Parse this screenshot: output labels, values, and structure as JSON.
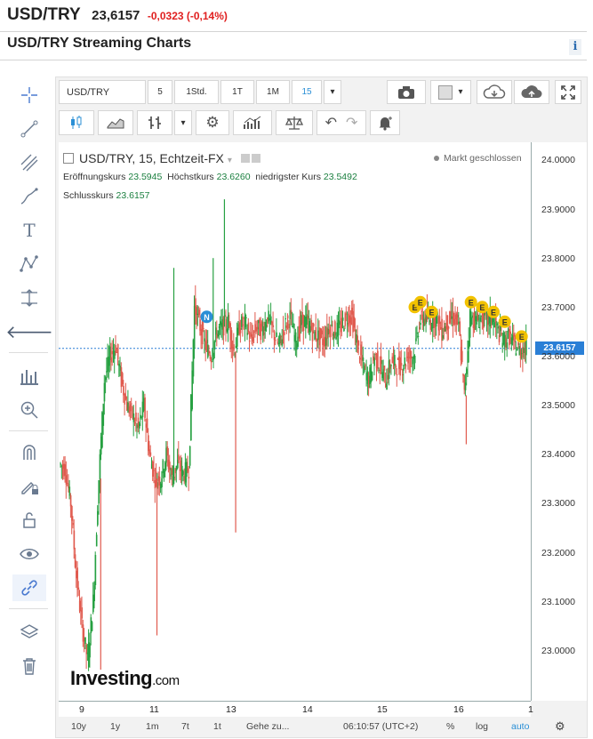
{
  "header": {
    "pair": "USD/TRY",
    "price": "23,6157",
    "change": "-0,0323 (-0,14%)"
  },
  "title": "USD/TRY Streaming Charts",
  "info_icon": "i",
  "toolbar": {
    "symbol": "USD/TRY",
    "intervals": [
      "5",
      "1Std.",
      "1T",
      "1M",
      "15"
    ],
    "active_interval": "15"
  },
  "legend": {
    "title": "USD/TRY, 15, Echtzeit-FX",
    "open_label": "Eröffnungskurs",
    "open": "23.5945",
    "high_label": "Höchstkurs",
    "high": "23.6260",
    "low_label": "niedrigster Kurs",
    "low": "23.5492",
    "close_label": "Schlusskurs",
    "close": "23.6157",
    "market_status": "Markt geschlossen"
  },
  "brand": {
    "name": "Investing",
    "suffix": ".com"
  },
  "price_tag": "23.6157",
  "bottom": {
    "ranges": [
      "10y",
      "1y",
      "1m",
      "7t",
      "1t"
    ],
    "goto": "Gehe zu...",
    "time": "06:10:57 (UTC+2)",
    "percent": "%",
    "log": "log",
    "auto": "auto"
  },
  "colors": {
    "up": "#26a041",
    "down": "#e05a4e",
    "accent": "#2a8fd6",
    "event": "#f2c200",
    "news": "#2a8fd6"
  },
  "chart_data": {
    "type": "candlestick",
    "interval": "15",
    "y_ticks": [
      23.0,
      23.1,
      23.2,
      23.3,
      23.4,
      23.5,
      23.6,
      23.7,
      23.8,
      23.9,
      24.0
    ],
    "y_tick_labels": [
      "23.0000",
      "23.1000",
      "23.2000",
      "23.3000",
      "23.4000",
      "23.5000",
      "23.6000",
      "23.7000",
      "23.8000",
      "23.9000",
      "24.0000"
    ],
    "ylim": [
      22.9,
      24.03
    ],
    "x_ticks": [
      9,
      11,
      13,
      14,
      15,
      16,
      1
    ],
    "x_tick_labels": [
      "9",
      "11",
      "13",
      "14",
      "15",
      "16",
      "1"
    ],
    "last_price": 23.6157,
    "price_path": [
      [
        0,
        23.38
      ],
      [
        1,
        23.37
      ],
      [
        2,
        23.3
      ],
      [
        3,
        23.15
      ],
      [
        4,
        23.05
      ],
      [
        5,
        22.98
      ],
      [
        6,
        23.1
      ],
      [
        7,
        23.35
      ],
      [
        8,
        23.55
      ],
      [
        9,
        23.6
      ],
      [
        10,
        23.62
      ],
      [
        11,
        23.55
      ],
      [
        12,
        23.5
      ],
      [
        13,
        23.48
      ],
      [
        14,
        23.45
      ],
      [
        15,
        23.5
      ],
      [
        16,
        23.4
      ],
      [
        17,
        23.35
      ],
      [
        18,
        23.35
      ],
      [
        19,
        23.4
      ],
      [
        20,
        23.35
      ],
      [
        21,
        23.38
      ],
      [
        22,
        23.36
      ],
      [
        23,
        23.37
      ],
      [
        24,
        23.7
      ],
      [
        25,
        23.66
      ],
      [
        26,
        23.62
      ],
      [
        27,
        23.6
      ],
      [
        28,
        23.65
      ],
      [
        29,
        23.66
      ],
      [
        30,
        23.67
      ],
      [
        31,
        23.61
      ],
      [
        32,
        23.66
      ],
      [
        33,
        23.67
      ],
      [
        34,
        23.63
      ],
      [
        35,
        23.66
      ],
      [
        36,
        23.65
      ],
      [
        37,
        23.68
      ],
      [
        38,
        23.65
      ],
      [
        39,
        23.62
      ],
      [
        40,
        23.66
      ],
      [
        41,
        23.68
      ],
      [
        42,
        23.63
      ],
      [
        43,
        23.67
      ],
      [
        44,
        23.67
      ],
      [
        45,
        23.65
      ],
      [
        46,
        23.64
      ],
      [
        47,
        23.63
      ],
      [
        48,
        23.66
      ],
      [
        49,
        23.65
      ],
      [
        50,
        23.66
      ],
      [
        51,
        23.68
      ],
      [
        52,
        23.68
      ],
      [
        53,
        23.62
      ],
      [
        54,
        23.58
      ],
      [
        55,
        23.55
      ],
      [
        56,
        23.6
      ],
      [
        57,
        23.58
      ],
      [
        58,
        23.55
      ],
      [
        59,
        23.59
      ],
      [
        60,
        23.58
      ],
      [
        61,
        23.58
      ],
      [
        62,
        23.6
      ],
      [
        63,
        23.6
      ],
      [
        64,
        23.67
      ],
      [
        65,
        23.68
      ],
      [
        66,
        23.67
      ],
      [
        67,
        23.68
      ],
      [
        68,
        23.65
      ],
      [
        69,
        23.67
      ],
      [
        70,
        23.68
      ],
      [
        71,
        23.66
      ],
      [
        72,
        23.52
      ],
      [
        73,
        23.68
      ],
      [
        74,
        23.67
      ],
      [
        75,
        23.68
      ],
      [
        76,
        23.67
      ],
      [
        77,
        23.68
      ],
      [
        78,
        23.65
      ],
      [
        79,
        23.63
      ],
      [
        80,
        23.64
      ],
      [
        81,
        23.62
      ],
      [
        82,
        23.61
      ],
      [
        83,
        23.62
      ]
    ],
    "spikes": [
      [
        29,
        23.92
      ],
      [
        31,
        23.24
      ],
      [
        27,
        23.8
      ],
      [
        17,
        23.03
      ],
      [
        7,
        22.96
      ],
      [
        20,
        23.78
      ],
      [
        72,
        23.42
      ]
    ],
    "events": [
      {
        "type": "N",
        "x": 26,
        "y": 23.68
      },
      {
        "type": "E",
        "x": 63,
        "y": 23.7
      },
      {
        "type": "E",
        "x": 64,
        "y": 23.71
      },
      {
        "type": "E",
        "x": 66,
        "y": 23.69
      },
      {
        "type": "E",
        "x": 73,
        "y": 23.71
      },
      {
        "type": "E",
        "x": 75,
        "y": 23.7
      },
      {
        "type": "E",
        "x": 77,
        "y": 23.69
      },
      {
        "type": "E",
        "x": 79,
        "y": 23.67
      },
      {
        "type": "E",
        "x": 82,
        "y": 23.64
      }
    ]
  }
}
